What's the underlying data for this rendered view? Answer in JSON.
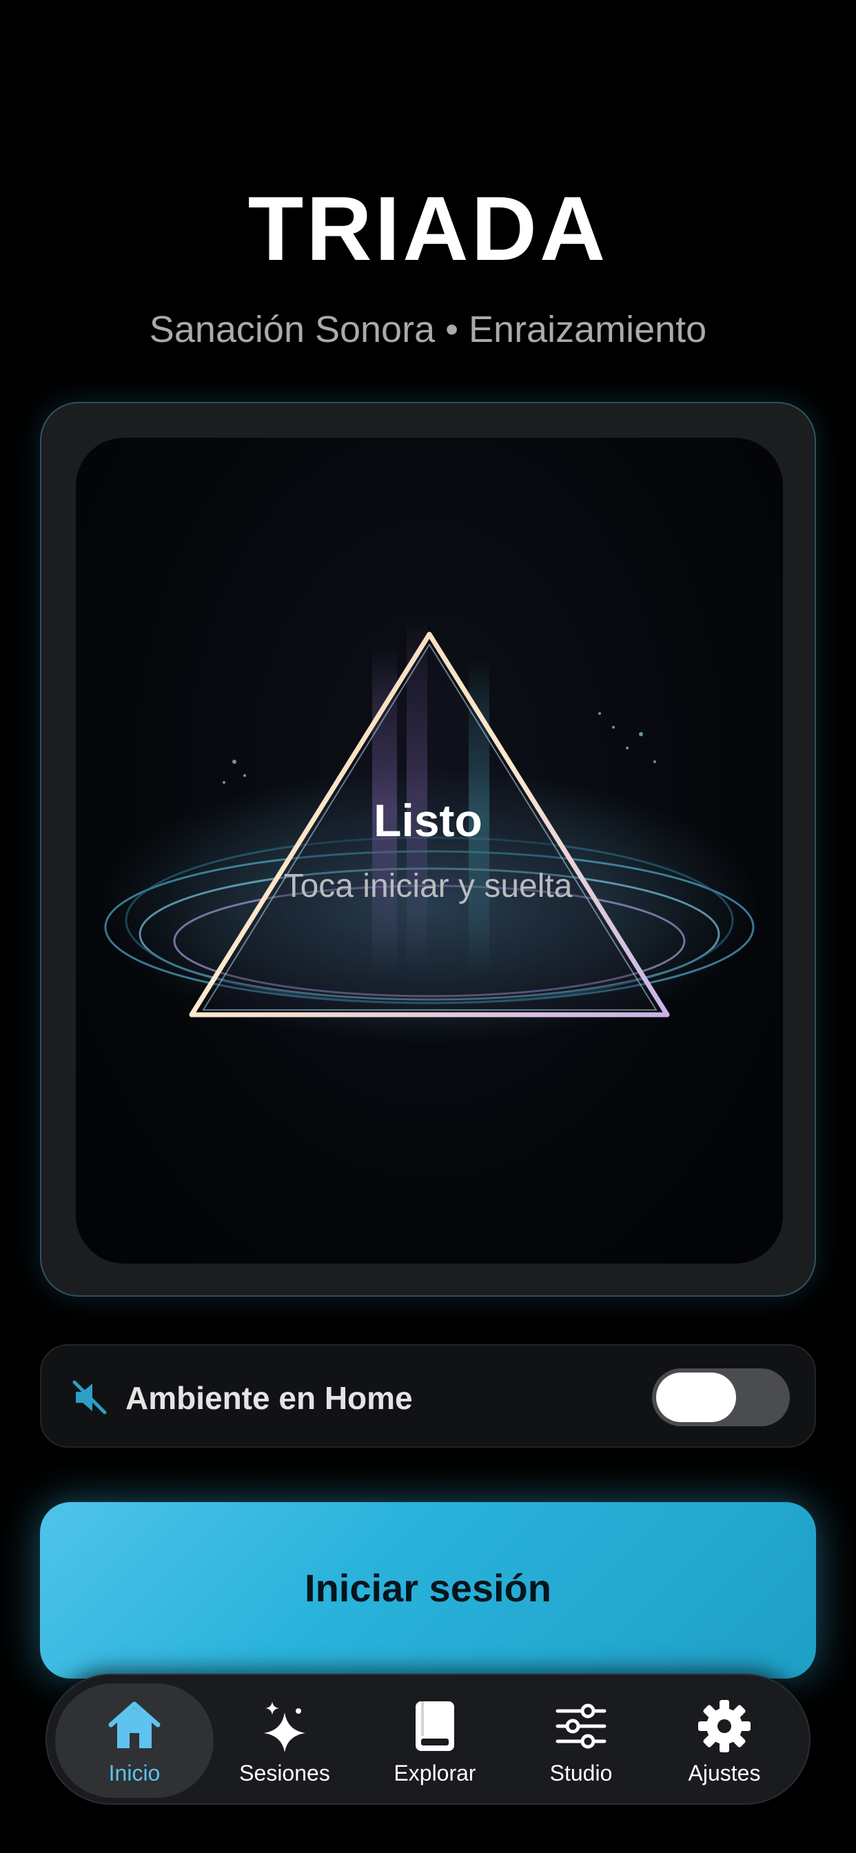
{
  "app": {
    "title": "TRIADA",
    "subtitle": "Sanación Sonora • Enraizamiento"
  },
  "hero": {
    "status_title": "Listo",
    "status_subtitle": "Toca iniciar y suelta"
  },
  "ambient": {
    "label": "Ambiente en Home",
    "icon": "speaker-muted-icon",
    "enabled": false
  },
  "start_button": {
    "label": "Iniciar sesión"
  },
  "tabs": [
    {
      "label": "Inicio",
      "icon": "home-icon",
      "active": true
    },
    {
      "label": "Sesiones",
      "icon": "sparkles-icon",
      "active": false
    },
    {
      "label": "Explorar",
      "icon": "book-icon",
      "active": false
    },
    {
      "label": "Studio",
      "icon": "sliders-icon",
      "active": false
    },
    {
      "label": "Ajustes",
      "icon": "gear-icon",
      "active": false
    }
  ],
  "colors": {
    "accent": "#5ec3ee",
    "button": "#2ab3dc",
    "background": "#000000"
  }
}
